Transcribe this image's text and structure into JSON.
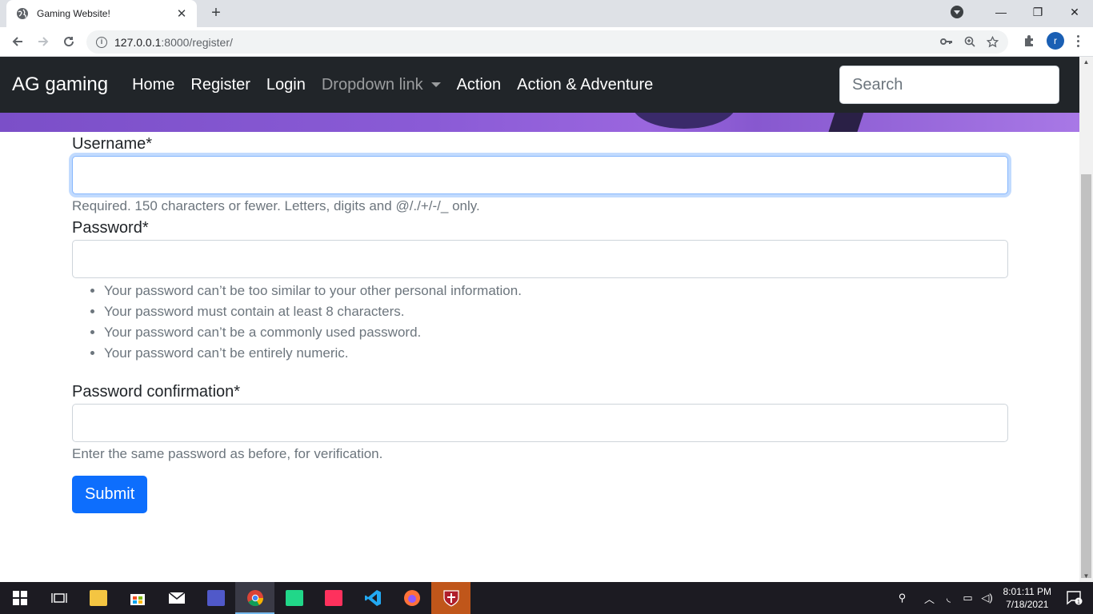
{
  "browser": {
    "tab_title": "Gaming Website!",
    "tab_close": "✕",
    "new_tab": "+",
    "url_host": "127.0.0.1",
    "url_rest": ":8000/register/",
    "profile_initial": "r",
    "window": {
      "minimize": "—",
      "restore": "❐",
      "close": "✕"
    }
  },
  "navbar": {
    "brand": "AG gaming",
    "links": [
      {
        "label": "Home"
      },
      {
        "label": "Register"
      },
      {
        "label": "Login"
      },
      {
        "label": "Dropdown link"
      },
      {
        "label": "Action"
      },
      {
        "label": "Action & Adventure"
      }
    ],
    "search_placeholder": "Search"
  },
  "form": {
    "username_label": "Username*",
    "username_help": "Required. 150 characters or fewer. Letters, digits and @/./+/-/_ only.",
    "password_label": "Password*",
    "password_help": [
      "Your password can’t be too similar to your other personal information.",
      "Your password must contain at least 8 characters.",
      "Your password can’t be a commonly used password.",
      "Your password can’t be entirely numeric."
    ],
    "confirm_label": "Password confirmation*",
    "confirm_help": "Enter the same password as before, for verification.",
    "submit_label": "Submit"
  },
  "taskbar": {
    "time": "8:01:11 PM",
    "date": "7/18/2021",
    "notification_count": "1"
  },
  "colors": {
    "navbar_bg": "#212529",
    "primary": "#0d6efd",
    "hero_purple": "#8a5bd6"
  }
}
